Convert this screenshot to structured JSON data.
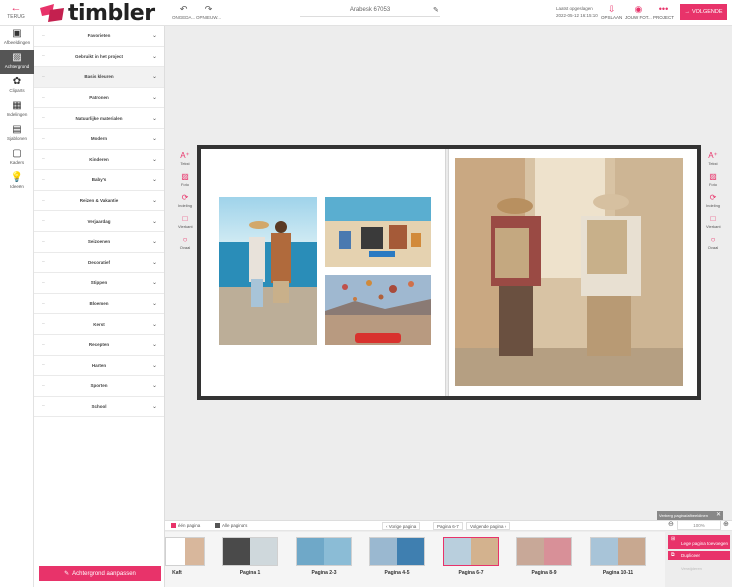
{
  "topbar": {
    "back_label": "TERUG",
    "logo_text": "timbler",
    "undo_label": "ONGEDA...",
    "redo_label": "OPNIEUW...",
    "project_name": "Arabesk 67053",
    "saved_label": "Laatst opgeslagen",
    "saved_time": "2022-05-12 16:15:10",
    "save_label": "OPSLAAN",
    "preview_label": "JOUW FOT...",
    "project_label": "PROJECT",
    "next_label": "VOLGENDE"
  },
  "rail": [
    {
      "label": "Afbeeldingen",
      "icon": "image-icon"
    },
    {
      "label": "Achtergrond",
      "icon": "background-icon"
    },
    {
      "label": "Cliparts",
      "icon": "clipart-icon"
    },
    {
      "label": "Indelingen",
      "icon": "layout-icon"
    },
    {
      "label": "Sjablonen",
      "icon": "template-icon"
    },
    {
      "label": "Kaders",
      "icon": "frame-icon"
    },
    {
      "label": "Ideeën",
      "icon": "lightbulb-icon"
    }
  ],
  "categories": [
    "Favorieten",
    "Gebruikt in het project",
    "Basis kleuren",
    "Patronen",
    "Natuurlijke materialen",
    "Modern",
    "Kinderen",
    "Baby's",
    "Reizen & Vakantie",
    "Verjaardag",
    "Seizoenen",
    "Decoratief",
    "Stippen",
    "Bloemen",
    "Kerst",
    "Recepten",
    "Harten",
    "Sporten",
    "School"
  ],
  "panel": {
    "button_label": "Achtergrond aanpassen"
  },
  "side_tools": [
    "Tekst",
    "Foto",
    "Indeling",
    "Vierkant",
    "Ovaal"
  ],
  "bottom": {
    "one_page_label": "één pagina",
    "all_pages_label": "Alle pagina's",
    "prev_label": "Vorige pagina",
    "current_label": "Pagina 6-7",
    "next_label": "Volgende pagina",
    "zoom_level": "100%"
  },
  "thumbs": [
    "Kaft",
    "Pagina 1",
    "Pagina 2-3",
    "Pagina 4-5",
    "Pagina 6-7",
    "Pagina 8-9",
    "Pagina 10-11"
  ],
  "actions": {
    "tooltip": "Verberg pagina/afbeeldinen",
    "add_page": "Lege pagina toevoegen",
    "duplicate": "Dupliceer",
    "disabled": "Verwijderen"
  },
  "colors": {
    "accent": "#e8336a"
  }
}
